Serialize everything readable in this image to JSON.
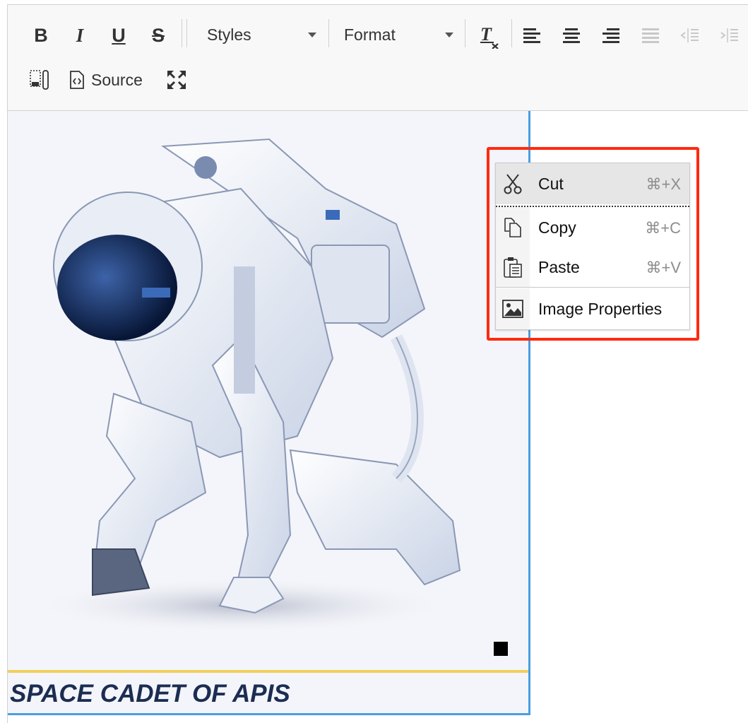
{
  "toolbar": {
    "styles_label": "Styles",
    "format_label": "Format",
    "source_label": "Source",
    "buttons": [
      "bold",
      "italic",
      "underline",
      "strikethrough",
      "remove-format",
      "align-left",
      "align-center",
      "align-right",
      "justify",
      "outdent",
      "indent",
      "show-blocks",
      "source",
      "maximize"
    ]
  },
  "content": {
    "caption": "SPACE CADET OF APIS",
    "image_alt": "astronaut kneeling"
  },
  "context_menu": {
    "items": [
      {
        "label": "Cut",
        "shortcut": "⌘+X",
        "icon": "scissors-icon"
      },
      {
        "label": "Copy",
        "shortcut": "⌘+C",
        "icon": "copy-icon"
      },
      {
        "label": "Paste",
        "shortcut": "⌘+V",
        "icon": "paste-icon"
      },
      {
        "label": "Image Properties",
        "shortcut": "",
        "icon": "image-icon"
      }
    ]
  },
  "colors": {
    "highlight_outline": "#ff2a10",
    "selection_border": "#4a9ee0",
    "caption_rule": "#f2cf5b",
    "caption_text": "#1b2d52"
  }
}
